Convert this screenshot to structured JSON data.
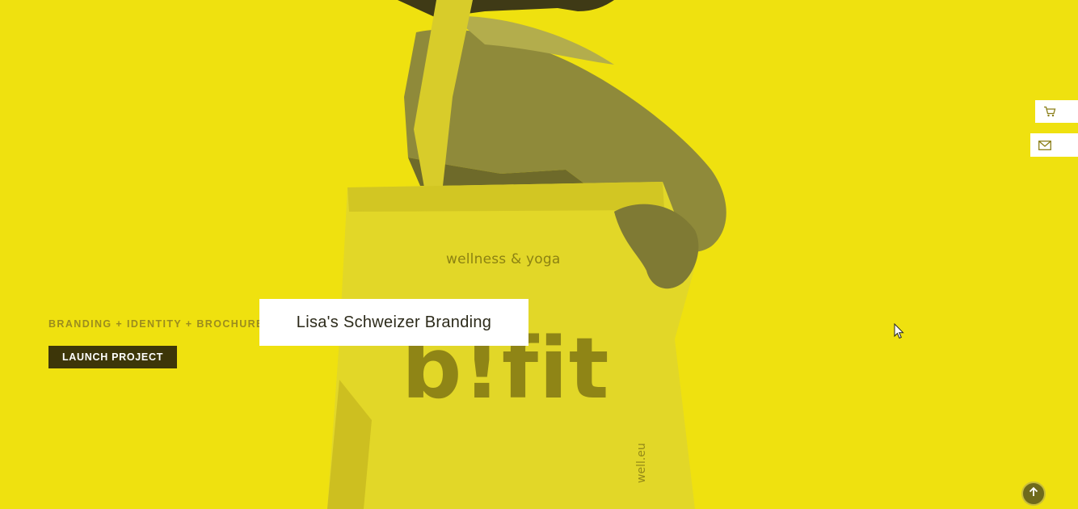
{
  "hero": {
    "bag_tagline": "wellness & yoga",
    "bag_logo": "b!fit",
    "bag_vertical_text": "well.eu"
  },
  "project": {
    "categories": "BRANDING + IDENTITY + BROCHURE",
    "launch_label": "LAUNCH PROJECT",
    "title": "Lisa's Schweizer Branding"
  },
  "side_tabs": {
    "cart_icon": "cart-icon",
    "mail_icon": "mail-icon"
  },
  "scroll_top_icon": "arrow-up-icon",
  "colors": {
    "background": "#efe10f",
    "button": "#3d3609",
    "card": "#ffffff"
  }
}
